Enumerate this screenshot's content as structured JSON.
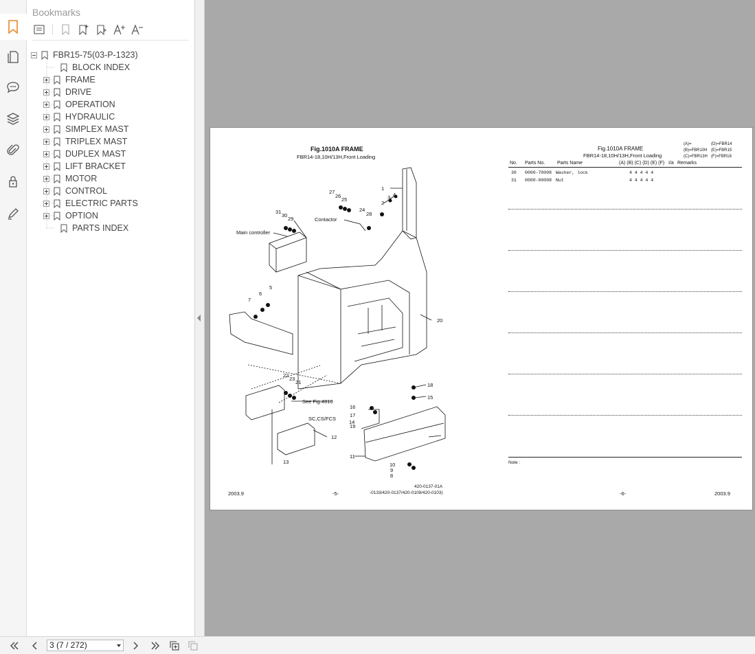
{
  "panel": {
    "title": "Bookmarks",
    "tree": [
      {
        "label": "FBR15-75(03-P-1323)",
        "level": 0,
        "expander": "minus"
      },
      {
        "label": "BLOCK INDEX",
        "level": 1,
        "expander": "none"
      },
      {
        "label": "FRAME",
        "level": 1,
        "expander": "plus"
      },
      {
        "label": "DRIVE",
        "level": 1,
        "expander": "plus"
      },
      {
        "label": "OPERATION",
        "level": 1,
        "expander": "plus"
      },
      {
        "label": "HYDRAULIC",
        "level": 1,
        "expander": "plus"
      },
      {
        "label": "SIMPLEX MAST",
        "level": 1,
        "expander": "plus"
      },
      {
        "label": "TRIPLEX MAST",
        "level": 1,
        "expander": "plus"
      },
      {
        "label": "DUPLEX MAST",
        "level": 1,
        "expander": "plus"
      },
      {
        "label": "LIFT BRACKET",
        "level": 1,
        "expander": "plus"
      },
      {
        "label": "MOTOR",
        "level": 1,
        "expander": "plus"
      },
      {
        "label": "CONTROL",
        "level": 1,
        "expander": "plus"
      },
      {
        "label": "ELECTRIC PARTS",
        "level": 1,
        "expander": "plus"
      },
      {
        "label": "OPTION",
        "level": 1,
        "expander": "plus"
      },
      {
        "label": "PARTS INDEX",
        "level": 1,
        "expander": "none"
      }
    ]
  },
  "rail": {
    "icons": [
      "bookmark-icon",
      "pages-icon",
      "comment-icon",
      "layers-icon",
      "attachment-icon",
      "lock-icon",
      "signature-icon"
    ],
    "accent": "#e8872a"
  },
  "document": {
    "left": {
      "fig_title": "Fig.1010A  FRAME",
      "fig_subtitle": "FBR14-18,10H/13H,Front Loading",
      "labels": {
        "main_controller": "Main controller",
        "contactor": "Contactor",
        "see_fig": "See Fig.4810",
        "sc_cs_fcs": "SC,CS/FCS"
      },
      "callouts": [
        "1",
        "2",
        "3",
        "4",
        "5",
        "6",
        "7",
        "8",
        "9",
        "10",
        "11",
        "12",
        "13",
        "14",
        "15",
        "16",
        "17",
        "18",
        "19",
        "20",
        "21",
        "22",
        "23",
        "24",
        "25",
        "26",
        "27",
        "28",
        "29",
        "30",
        "31"
      ],
      "footer_date": "2003.9",
      "footer_page": "-5-",
      "footer_code1": "420-0137-01A",
      "footer_code2": "-0133/420-0137/420-0109/420-0103)"
    },
    "right": {
      "fig_title": "Fig.1010A  FRAME",
      "fig_subtitle": "FBR14-18,10H/13H,Front Loading",
      "legend": [
        "(A)=",
        "(D)=FBR14",
        "(B)=FBR10H",
        "(E)=FBR15",
        "(C)=FBR13H",
        "(F)=FBR18"
      ],
      "headers": {
        "no": "No.",
        "parts_no": "Parts No.",
        "parts_name": "Parts Name",
        "models": "(A) (B) (C) (D) (E) (F)",
        "ia": "I/a",
        "remarks": "Remarks"
      },
      "rows": [
        {
          "no": "30",
          "parts_no": "0000-70008",
          "parts_name": "Washer, lock",
          "qty": "4  4  4  4  4"
        },
        {
          "no": "31",
          "parts_no": "0000-00008",
          "parts_name": "Nut",
          "qty": "4  4  4  4  4"
        }
      ],
      "note": "Note :",
      "footer_page": "-6-",
      "footer_date": "2003.9"
    }
  },
  "bottombar": {
    "page_value": "3 (7 / 272)"
  }
}
